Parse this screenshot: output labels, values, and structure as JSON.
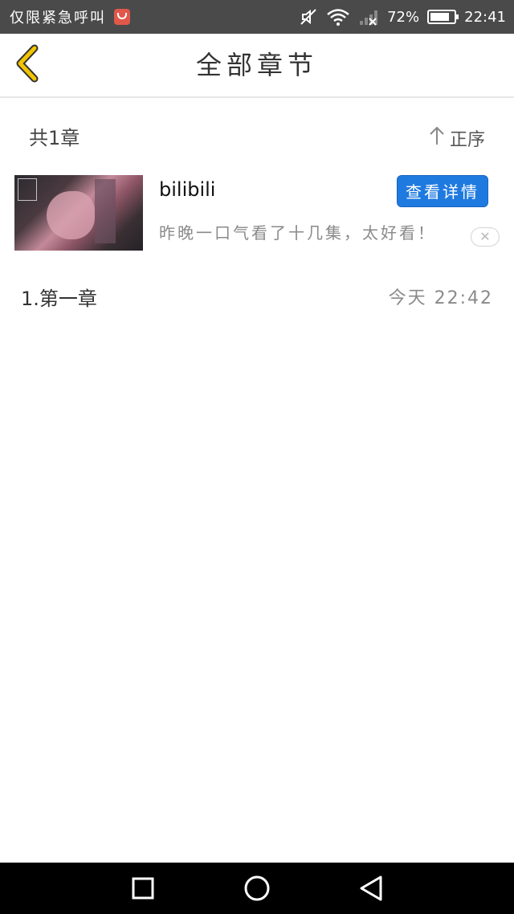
{
  "status_bar": {
    "carrier": "仅限紧急呼叫",
    "battery": "72%",
    "battery_level": 0.72,
    "time": "22:41",
    "icons": [
      "message-icon",
      "mute-icon",
      "wifi-icon",
      "signal-icon",
      "battery-icon"
    ]
  },
  "header": {
    "title": "全部章节",
    "back_icon": "chevron-left-icon",
    "accent_color": "#f2c400"
  },
  "chapter_list": {
    "count_label": "共1章",
    "sort_label": "正序",
    "sort_icon": "arrow-up-icon",
    "chapters": [
      {
        "title": "1.第一章",
        "time": "今天 22:42"
      }
    ]
  },
  "ad": {
    "name": "bilibili",
    "description": "昨晚一口气看了十几集，太好看！",
    "button_label": "查看详情",
    "button_color": "#1f7ae0",
    "close_icon": "close-icon"
  },
  "nav_bar": {
    "keys": [
      "square-icon",
      "circle-icon",
      "triangle-back-icon"
    ]
  }
}
